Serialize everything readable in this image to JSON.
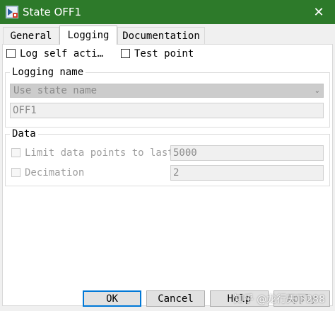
{
  "window": {
    "title": "State OFF1",
    "close_glyph": "✕"
  },
  "tabs": [
    {
      "label": "General"
    },
    {
      "label": "Logging"
    },
    {
      "label": "Documentation"
    }
  ],
  "options": {
    "log_self_activity_label": "Log self acti…",
    "test_point_label": "Test point"
  },
  "logging_name": {
    "legend": "Logging name",
    "select_value": "Use state name",
    "name_value": "OFF1"
  },
  "data_group": {
    "legend": "Data",
    "limit_label": "Limit data points to last",
    "limit_value": "5000",
    "decimation_label": "Decimation",
    "decimation_value": "2"
  },
  "buttons": {
    "ok": "OK",
    "cancel": "Cancel",
    "help": "Help",
    "apply": "Apply"
  },
  "watermark": "知乎 @龙行天下288",
  "colors": {
    "titlebar": "#2d7a2a",
    "default_button_border": "#0078d7"
  }
}
